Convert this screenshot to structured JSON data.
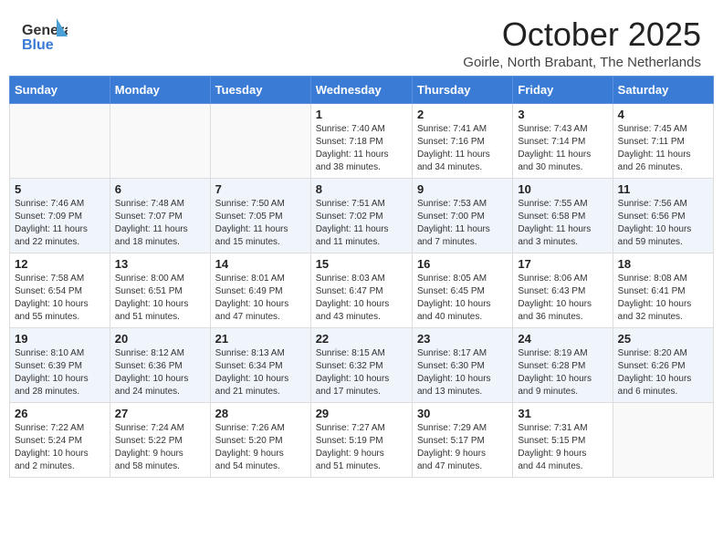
{
  "header": {
    "logo_general": "General",
    "logo_blue": "Blue",
    "month_title": "October 2025",
    "subtitle": "Goirle, North Brabant, The Netherlands"
  },
  "days_of_week": [
    "Sunday",
    "Monday",
    "Tuesday",
    "Wednesday",
    "Thursday",
    "Friday",
    "Saturday"
  ],
  "weeks": [
    [
      {
        "day": "",
        "info": ""
      },
      {
        "day": "",
        "info": ""
      },
      {
        "day": "",
        "info": ""
      },
      {
        "day": "1",
        "info": "Sunrise: 7:40 AM\nSunset: 7:18 PM\nDaylight: 11 hours\nand 38 minutes."
      },
      {
        "day": "2",
        "info": "Sunrise: 7:41 AM\nSunset: 7:16 PM\nDaylight: 11 hours\nand 34 minutes."
      },
      {
        "day": "3",
        "info": "Sunrise: 7:43 AM\nSunset: 7:14 PM\nDaylight: 11 hours\nand 30 minutes."
      },
      {
        "day": "4",
        "info": "Sunrise: 7:45 AM\nSunset: 7:11 PM\nDaylight: 11 hours\nand 26 minutes."
      }
    ],
    [
      {
        "day": "5",
        "info": "Sunrise: 7:46 AM\nSunset: 7:09 PM\nDaylight: 11 hours\nand 22 minutes."
      },
      {
        "day": "6",
        "info": "Sunrise: 7:48 AM\nSunset: 7:07 PM\nDaylight: 11 hours\nand 18 minutes."
      },
      {
        "day": "7",
        "info": "Sunrise: 7:50 AM\nSunset: 7:05 PM\nDaylight: 11 hours\nand 15 minutes."
      },
      {
        "day": "8",
        "info": "Sunrise: 7:51 AM\nSunset: 7:02 PM\nDaylight: 11 hours\nand 11 minutes."
      },
      {
        "day": "9",
        "info": "Sunrise: 7:53 AM\nSunset: 7:00 PM\nDaylight: 11 hours\nand 7 minutes."
      },
      {
        "day": "10",
        "info": "Sunrise: 7:55 AM\nSunset: 6:58 PM\nDaylight: 11 hours\nand 3 minutes."
      },
      {
        "day": "11",
        "info": "Sunrise: 7:56 AM\nSunset: 6:56 PM\nDaylight: 10 hours\nand 59 minutes."
      }
    ],
    [
      {
        "day": "12",
        "info": "Sunrise: 7:58 AM\nSunset: 6:54 PM\nDaylight: 10 hours\nand 55 minutes."
      },
      {
        "day": "13",
        "info": "Sunrise: 8:00 AM\nSunset: 6:51 PM\nDaylight: 10 hours\nand 51 minutes."
      },
      {
        "day": "14",
        "info": "Sunrise: 8:01 AM\nSunset: 6:49 PM\nDaylight: 10 hours\nand 47 minutes."
      },
      {
        "day": "15",
        "info": "Sunrise: 8:03 AM\nSunset: 6:47 PM\nDaylight: 10 hours\nand 43 minutes."
      },
      {
        "day": "16",
        "info": "Sunrise: 8:05 AM\nSunset: 6:45 PM\nDaylight: 10 hours\nand 40 minutes."
      },
      {
        "day": "17",
        "info": "Sunrise: 8:06 AM\nSunset: 6:43 PM\nDaylight: 10 hours\nand 36 minutes."
      },
      {
        "day": "18",
        "info": "Sunrise: 8:08 AM\nSunset: 6:41 PM\nDaylight: 10 hours\nand 32 minutes."
      }
    ],
    [
      {
        "day": "19",
        "info": "Sunrise: 8:10 AM\nSunset: 6:39 PM\nDaylight: 10 hours\nand 28 minutes."
      },
      {
        "day": "20",
        "info": "Sunrise: 8:12 AM\nSunset: 6:36 PM\nDaylight: 10 hours\nand 24 minutes."
      },
      {
        "day": "21",
        "info": "Sunrise: 8:13 AM\nSunset: 6:34 PM\nDaylight: 10 hours\nand 21 minutes."
      },
      {
        "day": "22",
        "info": "Sunrise: 8:15 AM\nSunset: 6:32 PM\nDaylight: 10 hours\nand 17 minutes."
      },
      {
        "day": "23",
        "info": "Sunrise: 8:17 AM\nSunset: 6:30 PM\nDaylight: 10 hours\nand 13 minutes."
      },
      {
        "day": "24",
        "info": "Sunrise: 8:19 AM\nSunset: 6:28 PM\nDaylight: 10 hours\nand 9 minutes."
      },
      {
        "day": "25",
        "info": "Sunrise: 8:20 AM\nSunset: 6:26 PM\nDaylight: 10 hours\nand 6 minutes."
      }
    ],
    [
      {
        "day": "26",
        "info": "Sunrise: 7:22 AM\nSunset: 5:24 PM\nDaylight: 10 hours\nand 2 minutes."
      },
      {
        "day": "27",
        "info": "Sunrise: 7:24 AM\nSunset: 5:22 PM\nDaylight: 9 hours\nand 58 minutes."
      },
      {
        "day": "28",
        "info": "Sunrise: 7:26 AM\nSunset: 5:20 PM\nDaylight: 9 hours\nand 54 minutes."
      },
      {
        "day": "29",
        "info": "Sunrise: 7:27 AM\nSunset: 5:19 PM\nDaylight: 9 hours\nand 51 minutes."
      },
      {
        "day": "30",
        "info": "Sunrise: 7:29 AM\nSunset: 5:17 PM\nDaylight: 9 hours\nand 47 minutes."
      },
      {
        "day": "31",
        "info": "Sunrise: 7:31 AM\nSunset: 5:15 PM\nDaylight: 9 hours\nand 44 minutes."
      },
      {
        "day": "",
        "info": ""
      }
    ]
  ]
}
